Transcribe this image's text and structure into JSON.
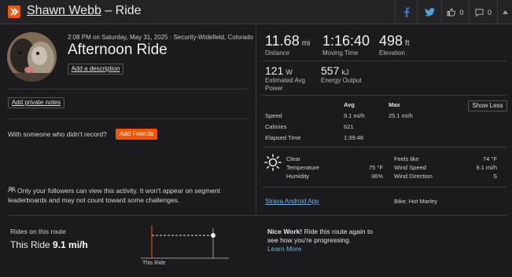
{
  "header": {
    "athlete_name": "Shawn Webb",
    "title_suffix": " – Ride",
    "kudos_count": "0",
    "comment_count": "0",
    "icons": [
      "strava-logo-icon",
      "facebook-icon",
      "twitter-icon",
      "thumbs-up-icon",
      "comment-icon",
      "caret-up-icon"
    ]
  },
  "activity": {
    "meta": "2:08 PM on Saturday, May 31, 2025 · Security-Widefield, Colorado",
    "title": "Afternoon Ride",
    "add_description": "Add a description",
    "add_private_notes": "Add private notes",
    "with_someone": "With someone who didn't record?",
    "add_friends": "Add Friends",
    "privacy_line1": "Only your followers can view this activity. It won't appear on segment",
    "privacy_line2": "leaderboards and may not count toward some challenges."
  },
  "stats": {
    "distance": {
      "value": "11.68",
      "unit": "mi",
      "label": "Distance"
    },
    "moving_time": {
      "value": "1:16:40",
      "label": "Moving Time"
    },
    "elevation": {
      "value": "498",
      "unit": "ft",
      "label": "Elevation"
    },
    "power": {
      "value": "121",
      "unit": "W",
      "label_1": "Estimated Avg",
      "label_2": "Power"
    },
    "energy": {
      "value": "557",
      "unit": "kJ",
      "label": "Energy Output"
    }
  },
  "details": {
    "col_avg": "Avg",
    "col_max": "Max",
    "show_less": "Show Less",
    "rows": [
      {
        "label": "Speed",
        "avg": "9.1 mi/h",
        "max": "25.1 mi/h"
      },
      {
        "label": "Calories",
        "avg": "621",
        "max": ""
      },
      {
        "label": "Elapsed Time",
        "avg": "1:39:48",
        "max": ""
      }
    ]
  },
  "weather": {
    "condition": "Clear",
    "temperature_label": "Temperature",
    "temperature": "75 °F",
    "humidity_label": "Humidity",
    "humidity": "36%",
    "feels_like_label": "Feels like",
    "feels_like": "74 °F",
    "wind_speed_label": "Wind Speed",
    "wind_speed": "9.1 mi/h",
    "wind_direction_label": "Wind Direction",
    "wind_direction": "S"
  },
  "device": {
    "app": "Strava Android App",
    "bike": "Bike: Hot Marley"
  },
  "route": {
    "heading": "Rides on this route",
    "this_ride_prefix": "This Ride",
    "this_ride_value": "9.1 mi/h",
    "chart_label": "This Ride",
    "nice_work": "Nice Work!",
    "msg_line1": " Ride this route again to",
    "msg_line2": "see how you're progressing.",
    "learn_more": "Learn More"
  },
  "colors": {
    "accent": "#fc5200",
    "background": "#1b1b1d",
    "link": "#6fb3e8"
  }
}
